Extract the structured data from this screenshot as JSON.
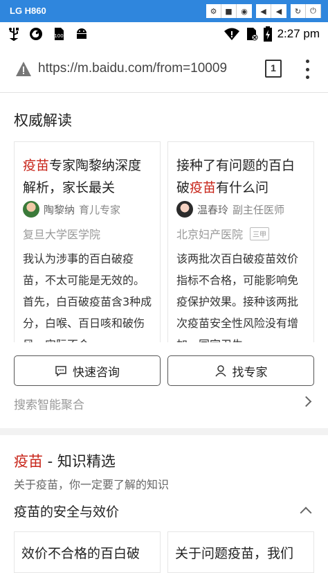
{
  "device": {
    "name": "LG H860",
    "buttons": [
      "⚙",
      "■",
      "◉",
      "◀",
      "◀",
      "↻",
      "⏻"
    ]
  },
  "status_bar": {
    "left_icons": [
      "usb-icon",
      "firefox-icon",
      "sim-100-icon",
      "android-icon"
    ],
    "time": "2:27 pm"
  },
  "browser": {
    "url": "https://m.baidu.com/from=10009",
    "tab_count": "1"
  },
  "authority": {
    "title": "权威解读",
    "cards": [
      {
        "title_highlight": "疫苗",
        "title_rest": "专家陶黎纳深度解析，家长最关",
        "author": "陶黎纳",
        "author_role": "育儿专家",
        "institution": "复旦大学医学院",
        "grade": "",
        "body": "我认为涉事的百白破疫苗，不太可能是无效的。首先，白百破疫苗含3种成分，白喉、百日咳和破伤风，实际不合"
      },
      {
        "title_pre": "接种了有问题的百白破",
        "title_highlight": "疫苗",
        "title_rest": "有什么问",
        "author": "温春玲",
        "author_role": "副主任医师",
        "institution": "北京妇产医院",
        "grade": "三甲",
        "body": "该两批次百白破疫苗效价指标不合格，可能影响免疫保护效果。接种该两批次疫苗安全性风险没有增加，国家卫生"
      }
    ],
    "quick_consult_label": "快速咨询",
    "find_expert_label": "找专家",
    "smart_aggregate": "搜索智能聚合"
  },
  "knowledge": {
    "title_highlight": "疫苗",
    "title_rest": " - 知识精选",
    "subtitle": "关于疫苗，你一定要了解的知识",
    "topic": "疫苗的安全与效价",
    "cards": [
      {
        "title": "效价不合格的百白破"
      },
      {
        "title": "关于问题疫苗，我们"
      }
    ]
  },
  "colors": {
    "highlight": "#c8261b",
    "device_bar": "#2f86dd"
  }
}
